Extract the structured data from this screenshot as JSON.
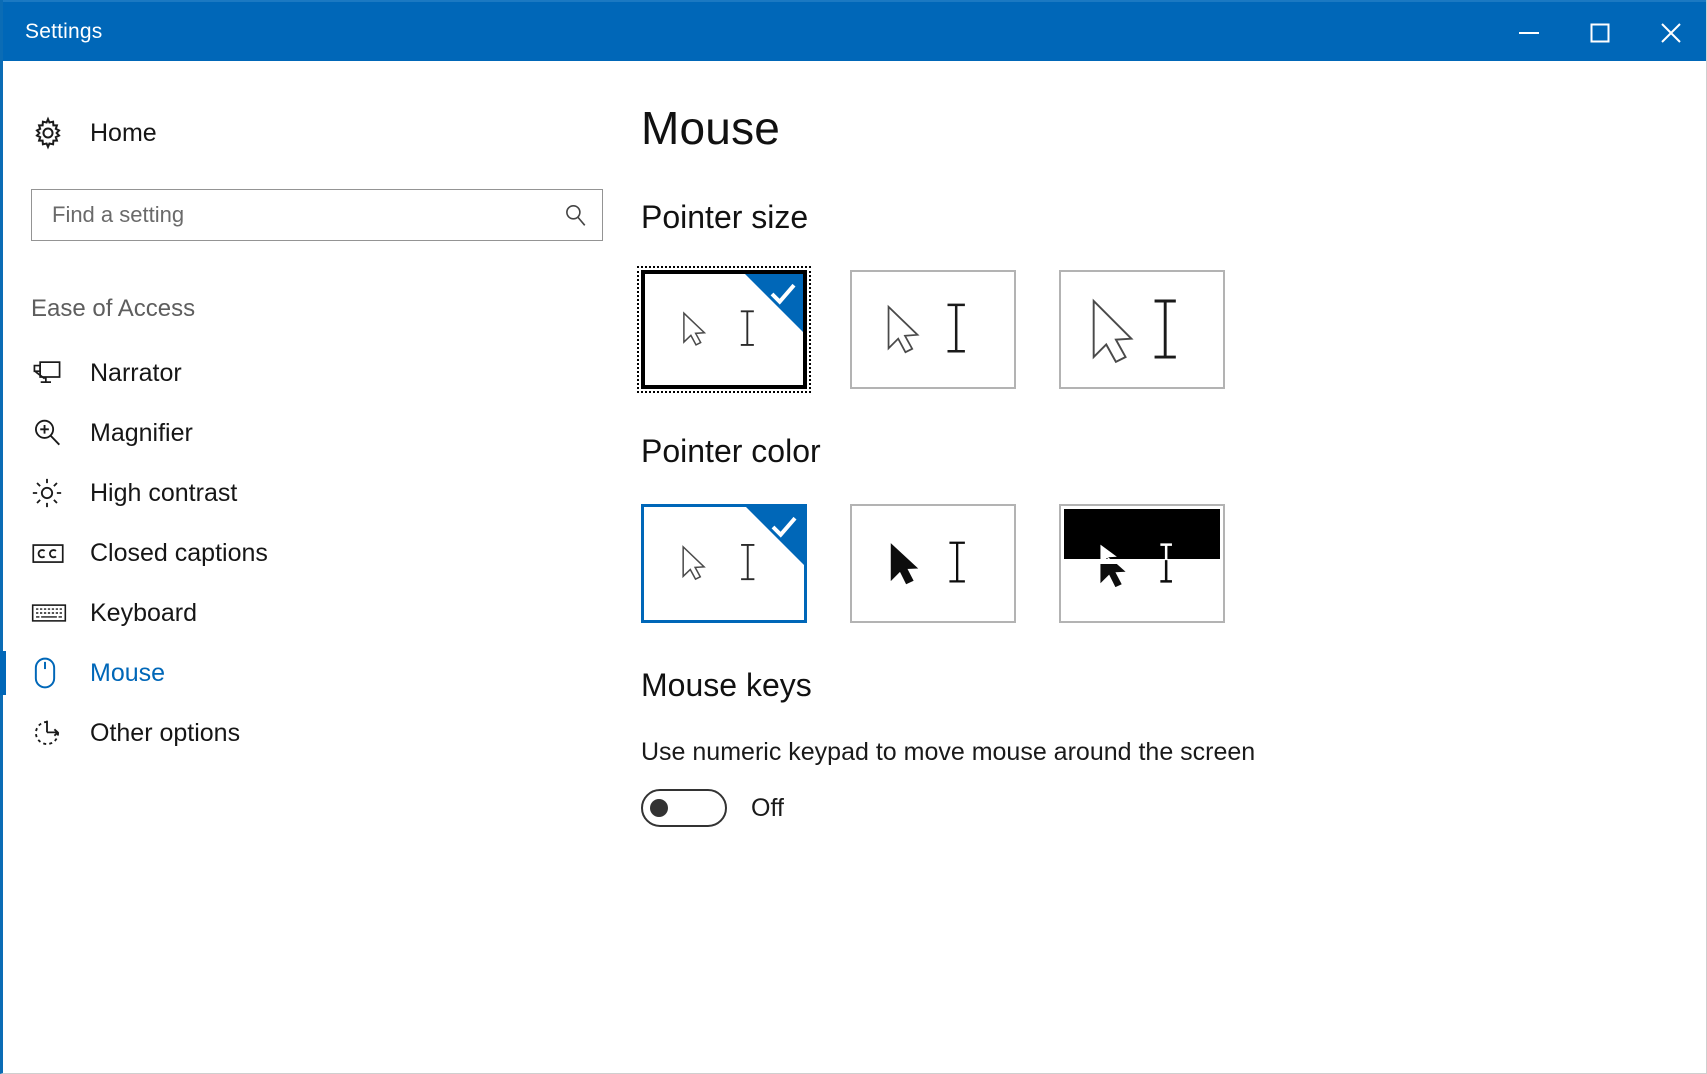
{
  "window": {
    "title": "Settings",
    "accent_color": "#0067b8",
    "titlebar_buttons": {
      "minimize": "minimize-icon",
      "maximize": "maximize-icon",
      "close": "close-icon"
    }
  },
  "sidebar": {
    "home": {
      "label": "Home",
      "icon": "gear-icon"
    },
    "search": {
      "placeholder": "Find a setting",
      "value": "",
      "icon": "search-icon"
    },
    "section_label": "Ease of Access",
    "items": [
      {
        "label": "Narrator",
        "icon": "narrator-icon",
        "selected": false
      },
      {
        "label": "Magnifier",
        "icon": "magnifier-icon",
        "selected": false
      },
      {
        "label": "High contrast",
        "icon": "high-contrast-icon",
        "selected": false
      },
      {
        "label": "Closed captions",
        "icon": "closed-captions-icon",
        "selected": false
      },
      {
        "label": "Keyboard",
        "icon": "keyboard-icon",
        "selected": false
      },
      {
        "label": "Mouse",
        "icon": "mouse-icon",
        "selected": true
      },
      {
        "label": "Other options",
        "icon": "other-options-icon",
        "selected": false
      }
    ]
  },
  "main": {
    "page_title": "Mouse",
    "pointer_size": {
      "title": "Pointer size",
      "options": [
        {
          "name": "small",
          "selected": true,
          "focused": true
        },
        {
          "name": "medium",
          "selected": false,
          "focused": false
        },
        {
          "name": "large",
          "selected": false,
          "focused": false
        }
      ]
    },
    "pointer_color": {
      "title": "Pointer color",
      "options": [
        {
          "name": "white",
          "selected": true,
          "focused": false
        },
        {
          "name": "black",
          "selected": false,
          "focused": false
        },
        {
          "name": "inverted",
          "selected": false,
          "focused": false
        }
      ]
    },
    "mouse_keys": {
      "title": "Mouse keys",
      "description": "Use numeric keypad to move mouse around the screen",
      "toggle_state": "Off",
      "toggle_on": false
    }
  }
}
